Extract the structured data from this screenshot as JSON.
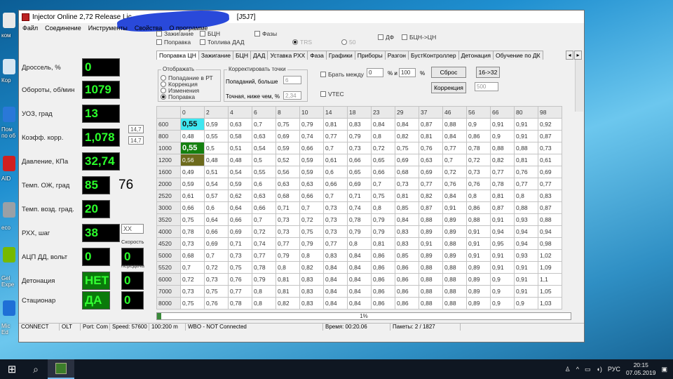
{
  "window": {
    "title": "Injector Online 2,72 Release  Lic",
    "title_suffix": "[J5J7]",
    "menu": [
      "Файл",
      "Соединение",
      "Инструменты",
      "Свойства",
      "О программе"
    ]
  },
  "gauges": [
    {
      "label": "Дроссель, %",
      "value": "0",
      "style": "black"
    },
    {
      "label": "Обороты, об/мин",
      "value": "1079",
      "style": "black"
    },
    {
      "label": "УОЗ, град",
      "value": "13",
      "style": "black"
    },
    {
      "label": "Коэфф. корр.",
      "value": "1,078",
      "style": "black"
    },
    {
      "label": "Давление, КПа",
      "value": "32,74",
      "style": "black"
    },
    {
      "label": "Темп. ОЖ, град",
      "value": "85",
      "style": "black"
    },
    {
      "label": "Темп. возд. град.",
      "value": "20",
      "style": "black"
    },
    {
      "label": "РХХ, шаг",
      "value": "38",
      "style": "black"
    },
    {
      "label": "АЦП ДД, вольт",
      "value": "0",
      "style": "black"
    },
    {
      "label": "Детонация",
      "value": "НЕТ",
      "style": "green"
    },
    {
      "label": "Стационар",
      "value": "ДА",
      "style": "green"
    }
  ],
  "side_values": {
    "koeff_a": "14,7",
    "koeff_b": "14,7",
    "temp_extra": "76",
    "rhh_box": "XX",
    "speed_label": "Скорость",
    "speed_value": "0",
    "gear_label": "передача",
    "gear_value": "0",
    "det_extra": "0",
    "stat_extra": "0"
  },
  "top_options": {
    "zazhiganie": "Зажигание",
    "bcn": "БЦН",
    "fazy": "Фазы",
    "popravka": "Поправка",
    "topliva_dad": "Топлива ДАД",
    "trs": "TRS",
    "val_50": "50",
    "df": "ДФ",
    "bcn_cn": "БЦН->ЦН"
  },
  "tabs": [
    "Поправка ЦН",
    "Зажигание",
    "БЦН",
    "ДАД",
    "Уставка РХХ",
    "Фаза",
    "Графики",
    "Приборы",
    "Разгон",
    "БустКонтроллер",
    "Детонация",
    "Обучение по ДК"
  ],
  "controls": {
    "display_group": "Отображать",
    "display_options": [
      "Попадание в РТ",
      "Коррекция",
      "Изменения",
      "Поправка"
    ],
    "correct_group": "Корректировать точки",
    "hits_label": "Попаданий, больше",
    "hits_value": "6",
    "accuracy_label": "Точная, ниже чем, %",
    "accuracy_value": "2,34",
    "brat_mezhdu": "Брать между",
    "between_from": "0",
    "and_label": "% и",
    "between_to": "100",
    "percent": "%",
    "vtec": "VTEC",
    "reset_button": "Сброс",
    "ratio_button": "16->32",
    "correction_button": "Коррекция",
    "correction_value": "500"
  },
  "grid": {
    "columns": [
      "0",
      "2",
      "4",
      "6",
      "8",
      "10",
      "14",
      "18",
      "23",
      "29",
      "37",
      "46",
      "56",
      "66",
      "80",
      "98"
    ],
    "rows": [
      {
        "rpm": "600",
        "cells": [
          "0,55",
          "0,59",
          "0,63",
          "0,7",
          "0,75",
          "0,79",
          "0,81",
          "0,83",
          "0,84",
          "0,84",
          "0,87",
          "0,88",
          "0,9",
          "0,91",
          "0,91",
          "0,92"
        ]
      },
      {
        "rpm": "800",
        "cells": [
          "0,48",
          "0,55",
          "0,58",
          "0,63",
          "0,69",
          "0,74",
          "0,77",
          "0,79",
          "0,8",
          "0,82",
          "0,81",
          "0,84",
          "0,86",
          "0,9",
          "0,91",
          "0,87"
        ]
      },
      {
        "rpm": "1000",
        "cells": [
          "0,55",
          "0,5",
          "0,51",
          "0,54",
          "0,59",
          "0,66",
          "0,7",
          "0,73",
          "0,72",
          "0,75",
          "0,76",
          "0,77",
          "0,78",
          "0,88",
          "0,88",
          "0,73"
        ]
      },
      {
        "rpm": "1200",
        "cells": [
          "0,56",
          "0,48",
          "0,48",
          "0,5",
          "0,52",
          "0,59",
          "0,61",
          "0,66",
          "0,65",
          "0,69",
          "0,63",
          "0,7",
          "0,72",
          "0,82",
          "0,81",
          "0,61"
        ]
      },
      {
        "rpm": "1600",
        "cells": [
          "0,49",
          "0,51",
          "0,54",
          "0,55",
          "0,56",
          "0,59",
          "0,6",
          "0,65",
          "0,66",
          "0,68",
          "0,69",
          "0,72",
          "0,73",
          "0,77",
          "0,76",
          "0,69"
        ]
      },
      {
        "rpm": "2000",
        "cells": [
          "0,59",
          "0,54",
          "0,59",
          "0,6",
          "0,63",
          "0,63",
          "0,66",
          "0,69",
          "0,7",
          "0,73",
          "0,77",
          "0,76",
          "0,76",
          "0,78",
          "0,77",
          "0,77"
        ]
      },
      {
        "rpm": "2520",
        "cells": [
          "0,61",
          "0,57",
          "0,62",
          "0,63",
          "0,68",
          "0,66",
          "0,7",
          "0,71",
          "0,75",
          "0,81",
          "0,82",
          "0,84",
          "0,8",
          "0,81",
          "0,8",
          "0,83"
        ]
      },
      {
        "rpm": "3000",
        "cells": [
          "0,66",
          "0,6",
          "0,64",
          "0,66",
          "0,71",
          "0,7",
          "0,73",
          "0,74",
          "0,8",
          "0,85",
          "0,87",
          "0,91",
          "0,86",
          "0,87",
          "0,88",
          "0,87"
        ]
      },
      {
        "rpm": "3520",
        "cells": [
          "0,75",
          "0,64",
          "0,66",
          "0,7",
          "0,73",
          "0,72",
          "0,73",
          "0,78",
          "0,79",
          "0,84",
          "0,88",
          "0,89",
          "0,88",
          "0,91",
          "0,93",
          "0,88"
        ]
      },
      {
        "rpm": "4000",
        "cells": [
          "0,78",
          "0,66",
          "0,69",
          "0,72",
          "0,73",
          "0,75",
          "0,73",
          "0,79",
          "0,79",
          "0,83",
          "0,89",
          "0,89",
          "0,91",
          "0,94",
          "0,94",
          "0,94"
        ]
      },
      {
        "rpm": "4520",
        "cells": [
          "0,73",
          "0,69",
          "0,71",
          "0,74",
          "0,77",
          "0,79",
          "0,77",
          "0,8",
          "0,81",
          "0,83",
          "0,91",
          "0,88",
          "0,91",
          "0,95",
          "0,94",
          "0,98"
        ]
      },
      {
        "rpm": "5000",
        "cells": [
          "0,68",
          "0,7",
          "0,73",
          "0,77",
          "0,79",
          "0,8",
          "0,83",
          "0,84",
          "0,86",
          "0,85",
          "0,89",
          "0,89",
          "0,91",
          "0,91",
          "0,93",
          "1,02"
        ]
      },
      {
        "rpm": "5520",
        "cells": [
          "0,7",
          "0,72",
          "0,75",
          "0,78",
          "0,8",
          "0,82",
          "0,84",
          "0,84",
          "0,86",
          "0,86",
          "0,88",
          "0,88",
          "0,89",
          "0,91",
          "0,91",
          "1,09"
        ]
      },
      {
        "rpm": "6000",
        "cells": [
          "0,72",
          "0,73",
          "0,76",
          "0,79",
          "0,81",
          "0,83",
          "0,84",
          "0,84",
          "0,86",
          "0,86",
          "0,88",
          "0,88",
          "0,89",
          "0,9",
          "0,91",
          "1,1"
        ]
      },
      {
        "rpm": "7000",
        "cells": [
          "0,73",
          "0,75",
          "0,77",
          "0,8",
          "0,81",
          "0,83",
          "0,84",
          "0,84",
          "0,86",
          "0,86",
          "0,88",
          "0,88",
          "0,89",
          "0,9",
          "0,91",
          "1,05"
        ]
      },
      {
        "rpm": "8000",
        "cells": [
          "0,75",
          "0,76",
          "0,78",
          "0,8",
          "0,82",
          "0,83",
          "0,84",
          "0,84",
          "0,86",
          "0,86",
          "0,88",
          "0,88",
          "0,89",
          "0,9",
          "0,9",
          "1,03"
        ]
      }
    ],
    "highlights": [
      {
        "row": 0,
        "col": 0,
        "color": "cyan"
      },
      {
        "row": 2,
        "col": 0,
        "color": "green"
      },
      {
        "row": 3,
        "col": 0,
        "color": "olive"
      }
    ]
  },
  "progress": {
    "percent": 1,
    "label": "1%"
  },
  "status": {
    "connect": "CONNECT",
    "olt": "OLT",
    "port": "Port: Com",
    "speed": "Speed: 57600",
    "interval": "100:200 m",
    "wbo": "WBO - NOT Connected",
    "time": "Время: 00:20.06",
    "packets": "Пакеты: 2 / 1827"
  },
  "taskbar": {
    "lang": "РУС",
    "time": "20:15",
    "date": "07.05.2019"
  },
  "desktop_labels": [
    "ком",
    "Кор",
    "Пом по об",
    "AID",
    "есо",
    "Gel Expe",
    "Mic Ed"
  ]
}
